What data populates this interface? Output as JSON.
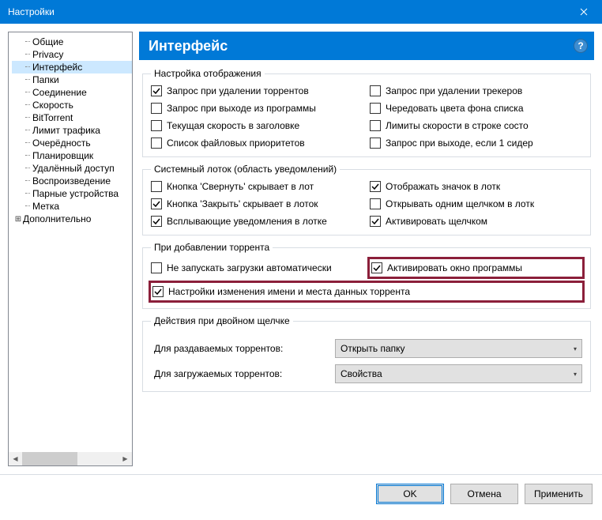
{
  "window": {
    "title": "Настройки"
  },
  "sidebar": {
    "items": [
      {
        "label": "Общие"
      },
      {
        "label": "Privacy"
      },
      {
        "label": "Интерфейс",
        "selected": true
      },
      {
        "label": "Папки"
      },
      {
        "label": "Соединение"
      },
      {
        "label": "Скорость"
      },
      {
        "label": "BitTorrent"
      },
      {
        "label": "Лимит трафика"
      },
      {
        "label": "Очерёдность"
      },
      {
        "label": "Планировщик"
      },
      {
        "label": "Удалённый доступ"
      },
      {
        "label": "Воспроизведение"
      },
      {
        "label": "Парные устройства"
      },
      {
        "label": "Метка"
      }
    ],
    "extra": {
      "label": "Дополнительно"
    }
  },
  "header": {
    "title": "Интерфейс"
  },
  "groups": {
    "display": {
      "legend": "Настройка отображения",
      "items": [
        {
          "label": "Запрос при удалении торрентов",
          "checked": true
        },
        {
          "label": "Запрос при удалении трекеров",
          "checked": false
        },
        {
          "label": "Запрос при выходе из программы",
          "checked": false
        },
        {
          "label": "Чередовать цвета фона списка",
          "checked": false
        },
        {
          "label": "Текущая скорость в заголовке",
          "checked": false
        },
        {
          "label": "Лимиты скорости в строке состо",
          "checked": false
        },
        {
          "label": "Список файловых приоритетов",
          "checked": false
        },
        {
          "label": "Запрос при выходе, если 1 сидер",
          "checked": false
        }
      ]
    },
    "tray": {
      "legend": "Системный лоток (область уведомлений)",
      "items": [
        {
          "label": "Кнопка 'Свернуть' скрывает в лот",
          "checked": false
        },
        {
          "label": "Отображать значок в лотк",
          "checked": true
        },
        {
          "label": "Кнопка 'Закрыть' скрывает в лоток",
          "checked": true
        },
        {
          "label": "Открывать одним щелчком в лотк",
          "checked": false
        },
        {
          "label": "Всплывающие уведомления в лотке",
          "checked": true
        },
        {
          "label": "Активировать щелчком",
          "checked": true
        }
      ]
    },
    "adding": {
      "legend": "При добавлении торрента",
      "items": [
        {
          "label": "Не запускать загрузки автоматически",
          "checked": false
        },
        {
          "label": "Активировать окно программы",
          "checked": true,
          "highlight": true
        },
        {
          "label": "Настройки изменения имени и места данных торрента",
          "checked": true,
          "highlight": true,
          "span": 2
        }
      ]
    },
    "dblclick": {
      "legend": "Действия при двойном щелчке",
      "rows": [
        {
          "label": "Для раздаваемых торрентов:",
          "value": "Открыть папку"
        },
        {
          "label": "Для загружаемых торрентов:",
          "value": "Свойства"
        }
      ]
    }
  },
  "footer": {
    "ok": "OK",
    "cancel": "Отмена",
    "apply": "Применить"
  }
}
